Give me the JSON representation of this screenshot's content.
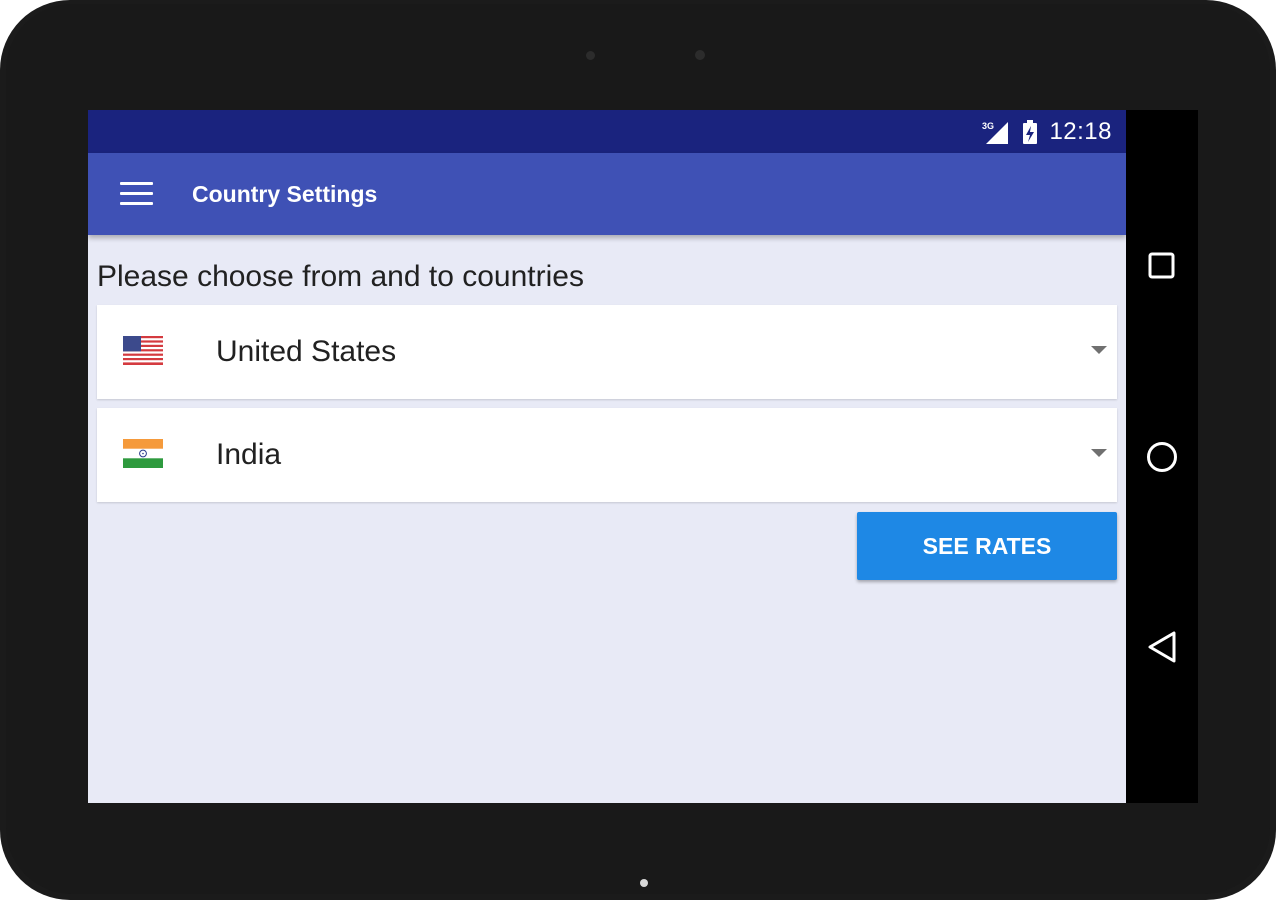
{
  "status_bar": {
    "network_label": "3G",
    "time": "12:18",
    "background_color": "#1a237e"
  },
  "toolbar": {
    "menu_icon": "hamburger-menu-icon",
    "title": "Country Settings",
    "background_color": "#3f51b5"
  },
  "content": {
    "prompt": "Please choose from and to countries",
    "from_country": {
      "name": "United States",
      "flag_icon": "us-flag-icon"
    },
    "to_country": {
      "name": "India",
      "flag_icon": "india-flag-icon"
    },
    "see_rates_label": "SEE RATES",
    "button_color": "#1e88e5",
    "background_color": "#e8eaf6"
  },
  "nav_bar": {
    "recents_icon": "square-recents-icon",
    "home_icon": "circle-home-icon",
    "back_icon": "triangle-back-icon"
  }
}
